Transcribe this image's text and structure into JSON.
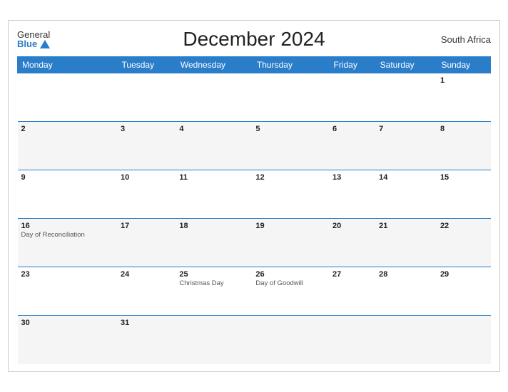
{
  "header": {
    "logo_general": "General",
    "logo_blue": "Blue",
    "title": "December 2024",
    "country": "South Africa"
  },
  "weekdays": [
    "Monday",
    "Tuesday",
    "Wednesday",
    "Thursday",
    "Friday",
    "Saturday",
    "Sunday"
  ],
  "weeks": [
    [
      {
        "day": "",
        "event": ""
      },
      {
        "day": "",
        "event": ""
      },
      {
        "day": "",
        "event": ""
      },
      {
        "day": "",
        "event": ""
      },
      {
        "day": "",
        "event": ""
      },
      {
        "day": "",
        "event": ""
      },
      {
        "day": "1",
        "event": ""
      }
    ],
    [
      {
        "day": "2",
        "event": ""
      },
      {
        "day": "3",
        "event": ""
      },
      {
        "day": "4",
        "event": ""
      },
      {
        "day": "5",
        "event": ""
      },
      {
        "day": "6",
        "event": ""
      },
      {
        "day": "7",
        "event": ""
      },
      {
        "day": "8",
        "event": ""
      }
    ],
    [
      {
        "day": "9",
        "event": ""
      },
      {
        "day": "10",
        "event": ""
      },
      {
        "day": "11",
        "event": ""
      },
      {
        "day": "12",
        "event": ""
      },
      {
        "day": "13",
        "event": ""
      },
      {
        "day": "14",
        "event": ""
      },
      {
        "day": "15",
        "event": ""
      }
    ],
    [
      {
        "day": "16",
        "event": "Day of\nReconciliation"
      },
      {
        "day": "17",
        "event": ""
      },
      {
        "day": "18",
        "event": ""
      },
      {
        "day": "19",
        "event": ""
      },
      {
        "day": "20",
        "event": ""
      },
      {
        "day": "21",
        "event": ""
      },
      {
        "day": "22",
        "event": ""
      }
    ],
    [
      {
        "day": "23",
        "event": ""
      },
      {
        "day": "24",
        "event": ""
      },
      {
        "day": "25",
        "event": "Christmas Day"
      },
      {
        "day": "26",
        "event": "Day of Goodwill"
      },
      {
        "day": "27",
        "event": ""
      },
      {
        "day": "28",
        "event": ""
      },
      {
        "day": "29",
        "event": ""
      }
    ],
    [
      {
        "day": "30",
        "event": ""
      },
      {
        "day": "31",
        "event": ""
      },
      {
        "day": "",
        "event": ""
      },
      {
        "day": "",
        "event": ""
      },
      {
        "day": "",
        "event": ""
      },
      {
        "day": "",
        "event": ""
      },
      {
        "day": "",
        "event": ""
      }
    ]
  ]
}
